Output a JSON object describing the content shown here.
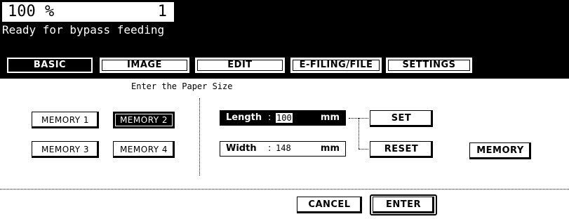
{
  "status": {
    "zoom": "100 %",
    "copies": "1",
    "message": "Ready for bypass feeding"
  },
  "tabs": [
    {
      "label": "BASIC",
      "active": true
    },
    {
      "label": "IMAGE",
      "active": false
    },
    {
      "label": "EDIT",
      "active": false
    },
    {
      "label": "E-FILING/FILE",
      "active": false
    },
    {
      "label": "SETTINGS",
      "active": false
    }
  ],
  "main": {
    "instruction": "Enter the Paper Size",
    "memory_buttons": [
      {
        "label": "MEMORY 1",
        "selected": false
      },
      {
        "label": "MEMORY 2",
        "selected": true
      },
      {
        "label": "MEMORY 3",
        "selected": false
      },
      {
        "label": "MEMORY 4",
        "selected": false
      }
    ],
    "length": {
      "label": "Length",
      "colon": ":",
      "value": "100",
      "unit": "mm"
    },
    "width": {
      "label": "Width",
      "colon": ":",
      "value": "148",
      "unit": "mm"
    },
    "set_label": "SET",
    "reset_label": "RESET",
    "memory_label": "MEMORY"
  },
  "footer": {
    "cancel_label": "CANCEL",
    "enter_label": "ENTER"
  }
}
